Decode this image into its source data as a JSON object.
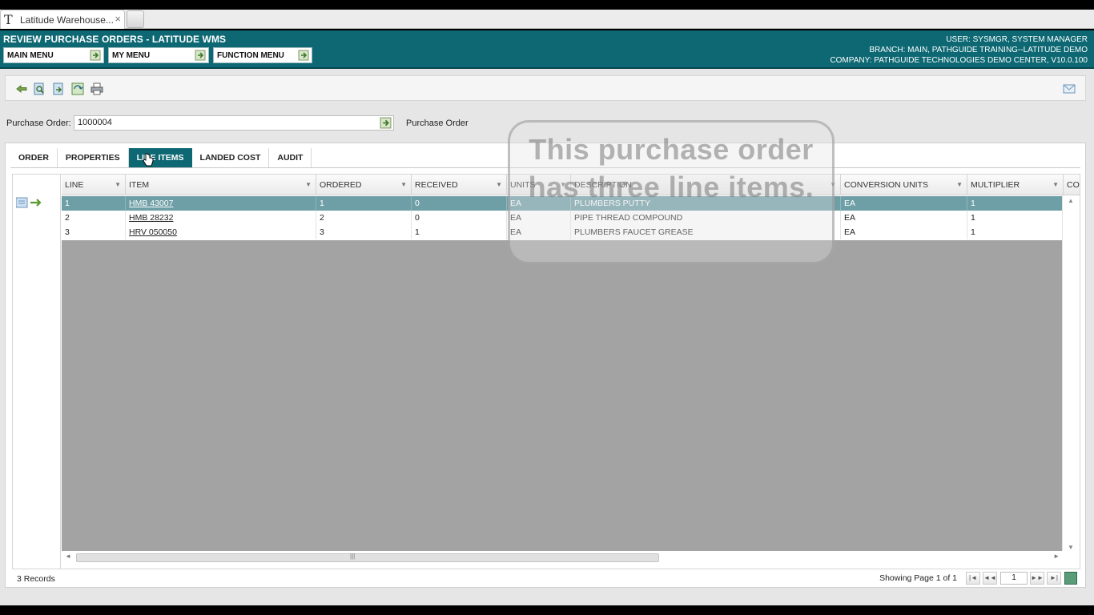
{
  "browser": {
    "tab_title": "Latitude Warehouse...",
    "close_glyph": "×"
  },
  "header": {
    "title": "REVIEW PURCHASE ORDERS - LATITUDE WMS",
    "menus": [
      {
        "label": "MAIN MENU"
      },
      {
        "label": "MY MENU"
      },
      {
        "label": "FUNCTION MENU"
      }
    ],
    "user_line": "USER: SYSMGR, SYSTEM MANAGER",
    "branch_line": "BRANCH: MAIN, PATHGUIDE TRAINING--LATITUDE DEMO",
    "company_line": "COMPANY: PATHGUIDE TECHNOLOGIES DEMO CENTER, V10.0.100"
  },
  "toolbar": {
    "icons": [
      "back-icon",
      "search-icon",
      "export-icon",
      "refresh-icon",
      "print-icon",
      "mail-icon"
    ]
  },
  "purchase_order": {
    "label": "Purchase Order:",
    "value": "1000004",
    "description": "Purchase Order"
  },
  "tabs": [
    {
      "label": "ORDER"
    },
    {
      "label": "PROPERTIES"
    },
    {
      "label": "LINE ITEMS"
    },
    {
      "label": "LANDED COST"
    },
    {
      "label": "AUDIT"
    }
  ],
  "active_tab": "LINE ITEMS",
  "grid": {
    "columns": [
      "LINE",
      "ITEM",
      "ORDERED",
      "RECEIVED",
      "UNITS",
      "DESCRIPTION",
      "CONVERSION UNITS",
      "MULTIPLIER",
      "CO"
    ],
    "rows": [
      {
        "line": "1",
        "item": "HMB 43007",
        "ordered": "1",
        "received": "0",
        "units": "EA",
        "description": "PLUMBERS PUTTY",
        "conversion_units": "EA",
        "multiplier": "1"
      },
      {
        "line": "2",
        "item": "HMB 28232",
        "ordered": "2",
        "received": "0",
        "units": "EA",
        "description": "PIPE THREAD COMPOUND",
        "conversion_units": "EA",
        "multiplier": "1"
      },
      {
        "line": "3",
        "item": "HRV 050050",
        "ordered": "3",
        "received": "1",
        "units": "EA",
        "description": "PLUMBERS FAUCET GREASE",
        "conversion_units": "EA",
        "multiplier": "1"
      }
    ],
    "selected_row": 0
  },
  "footer": {
    "records": "3 Records",
    "page_info": "Showing Page 1 of 1",
    "page_value": "1"
  },
  "callout": {
    "text": "This purchase order has three line items."
  },
  "colors": {
    "header_bg": "#0d6873",
    "selected_row": "#6f9fa6",
    "grid_empty": "#a3a3a3"
  }
}
